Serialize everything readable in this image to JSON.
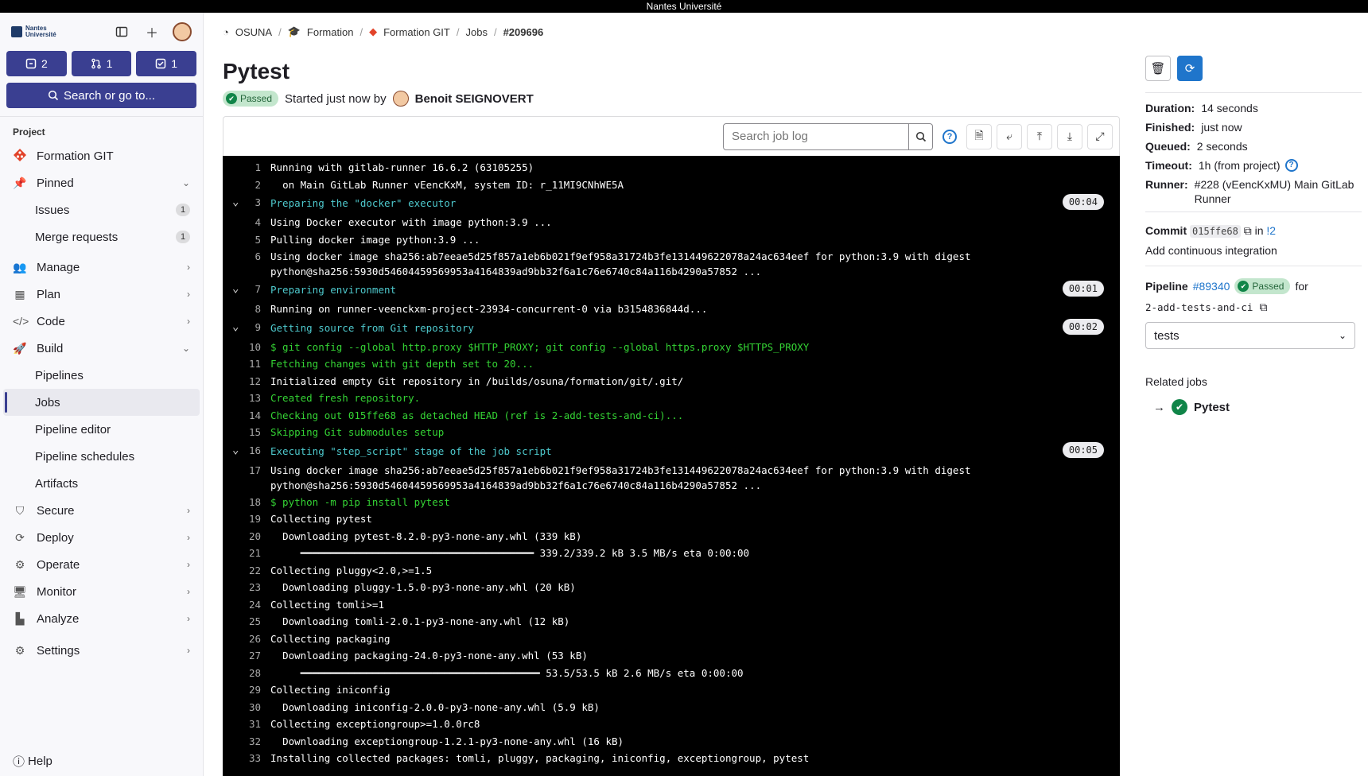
{
  "os_bar": {
    "title": "Nantes Université"
  },
  "sidebar": {
    "logo_text_1": "Nantes",
    "logo_text_2": "Université",
    "counts": [
      {
        "icon": "issues-icon",
        "value": "2"
      },
      {
        "icon": "merge-request-icon",
        "value": "1"
      },
      {
        "icon": "todo-icon",
        "value": "1"
      }
    ],
    "search_label": "Search or go to...",
    "section_title": "Project",
    "project_name": "Formation GIT",
    "pinned_label": "Pinned",
    "pinned_items": [
      {
        "label": "Issues",
        "badge": "1"
      },
      {
        "label": "Merge requests",
        "badge": "1"
      }
    ],
    "manage": "Manage",
    "plan": "Plan",
    "code": "Code",
    "build": "Build",
    "build_items": [
      "Pipelines",
      "Jobs",
      "Pipeline editor",
      "Pipeline schedules",
      "Artifacts"
    ],
    "secure": "Secure",
    "deploy": "Deploy",
    "operate": "Operate",
    "monitor": "Monitor",
    "analyze": "Analyze",
    "settings": "Settings",
    "help": "Help"
  },
  "breadcrumb": [
    "OSUNA",
    "Formation",
    "Formation GIT",
    "Jobs",
    "#209696"
  ],
  "job": {
    "title": "Pytest",
    "status": "Passed",
    "started_text": "Started just now by",
    "user": "Benoit SEIGNOVERT"
  },
  "toolbar": {
    "search_placeholder": "Search job log"
  },
  "log": [
    {
      "n": "1",
      "t": "Running with gitlab-runner 16.6.2 (63105255)",
      "c": ""
    },
    {
      "n": "2",
      "t": "  on Main GitLab Runner vEencKxM, system ID: r_11MI9CNhWE5A",
      "c": ""
    },
    {
      "n": "3",
      "t": "Preparing the \"docker\" executor",
      "c": "cyan",
      "section": true,
      "time": "00:04"
    },
    {
      "n": "4",
      "t": "Using Docker executor with image python:3.9 ...",
      "c": ""
    },
    {
      "n": "5",
      "t": "Pulling docker image python:3.9 ...",
      "c": ""
    },
    {
      "n": "6",
      "t": "Using docker image sha256:ab7eeae5d25f857a1eb6b021f9ef958a31724b3fe131449622078a24ac634eef for python:3.9 with digest python@sha256:5930d54604459569953a4164839ad9bb32f6a1c76e6740c84a116b4290a57852 ...",
      "c": ""
    },
    {
      "n": "7",
      "t": "Preparing environment",
      "c": "cyan",
      "section": true,
      "time": "00:01"
    },
    {
      "n": "8",
      "t": "Running on runner-veenckxm-project-23934-concurrent-0 via b3154836844d...",
      "c": ""
    },
    {
      "n": "9",
      "t": "Getting source from Git repository",
      "c": "cyan",
      "section": true,
      "time": "00:02"
    },
    {
      "n": "10",
      "t": "$ git config --global http.proxy $HTTP_PROXY; git config --global https.proxy $HTTPS_PROXY",
      "c": "green"
    },
    {
      "n": "11",
      "t": "Fetching changes with git depth set to 20...",
      "c": "green"
    },
    {
      "n": "12",
      "t": "Initialized empty Git repository in /builds/osuna/formation/git/.git/",
      "c": ""
    },
    {
      "n": "13",
      "t": "Created fresh repository.",
      "c": "green"
    },
    {
      "n": "14",
      "t": "Checking out 015ffe68 as detached HEAD (ref is 2-add-tests-and-ci)...",
      "c": "green"
    },
    {
      "n": "15",
      "t": "Skipping Git submodules setup",
      "c": "green"
    },
    {
      "n": "16",
      "t": "Executing \"step_script\" stage of the job script",
      "c": "cyan",
      "section": true,
      "time": "00:05"
    },
    {
      "n": "17",
      "t": "Using docker image sha256:ab7eeae5d25f857a1eb6b021f9ef958a31724b3fe131449622078a24ac634eef for python:3.9 with digest python@sha256:5930d54604459569953a4164839ad9bb32f6a1c76e6740c84a116b4290a57852 ...",
      "c": ""
    },
    {
      "n": "18",
      "t": "$ python -m pip install pytest",
      "c": "green"
    },
    {
      "n": "19",
      "t": "Collecting pytest",
      "c": ""
    },
    {
      "n": "20",
      "t": "  Downloading pytest-8.2.0-py3-none-any.whl (339 kB)",
      "c": ""
    },
    {
      "n": "21",
      "t": "     ━━━━━━━━━━━━━━━━━━━━━━━━━━━━━━━━━━━━━━━ 339.2/339.2 kB 3.5 MB/s eta 0:00:00",
      "c": ""
    },
    {
      "n": "22",
      "t": "Collecting pluggy<2.0,>=1.5",
      "c": ""
    },
    {
      "n": "23",
      "t": "  Downloading pluggy-1.5.0-py3-none-any.whl (20 kB)",
      "c": ""
    },
    {
      "n": "24",
      "t": "Collecting tomli>=1",
      "c": ""
    },
    {
      "n": "25",
      "t": "  Downloading tomli-2.0.1-py3-none-any.whl (12 kB)",
      "c": ""
    },
    {
      "n": "26",
      "t": "Collecting packaging",
      "c": ""
    },
    {
      "n": "27",
      "t": "  Downloading packaging-24.0-py3-none-any.whl (53 kB)",
      "c": ""
    },
    {
      "n": "28",
      "t": "     ━━━━━━━━━━━━━━━━━━━━━━━━━━━━━━━━━━━━━━━━ 53.5/53.5 kB 2.6 MB/s eta 0:00:00",
      "c": ""
    },
    {
      "n": "29",
      "t": "Collecting iniconfig",
      "c": ""
    },
    {
      "n": "30",
      "t": "  Downloading iniconfig-2.0.0-py3-none-any.whl (5.9 kB)",
      "c": ""
    },
    {
      "n": "31",
      "t": "Collecting exceptiongroup>=1.0.0rc8",
      "c": ""
    },
    {
      "n": "32",
      "t": "  Downloading exceptiongroup-1.2.1-py3-none-any.whl (16 kB)",
      "c": ""
    },
    {
      "n": "33",
      "t": "Installing collected packages: tomli, pluggy, packaging, iniconfig, exceptiongroup, pytest",
      "c": ""
    }
  ],
  "meta": {
    "duration_k": "Duration:",
    "duration_v": "14 seconds",
    "finished_k": "Finished:",
    "finished_v": "just now",
    "queued_k": "Queued:",
    "queued_v": "2 seconds",
    "timeout_k": "Timeout:",
    "timeout_v": "1h (from project)",
    "runner_k": "Runner:",
    "runner_v": "#228 (vEencKxMU) Main GitLab Runner"
  },
  "commit": {
    "label": "Commit",
    "sha": "015ffe68",
    "in": "in",
    "mr": "!2",
    "message": "Add continuous integration"
  },
  "pipeline": {
    "label": "Pipeline",
    "id": "#89340",
    "status": "Passed",
    "for": "for",
    "branch": "2-add-tests-and-ci",
    "stage": "tests"
  },
  "related": {
    "title": "Related jobs",
    "job": "Pytest"
  },
  "colors": {
    "accent": "#1f75cb",
    "sidebar_button": "#3a3f91",
    "success": "#108548"
  }
}
